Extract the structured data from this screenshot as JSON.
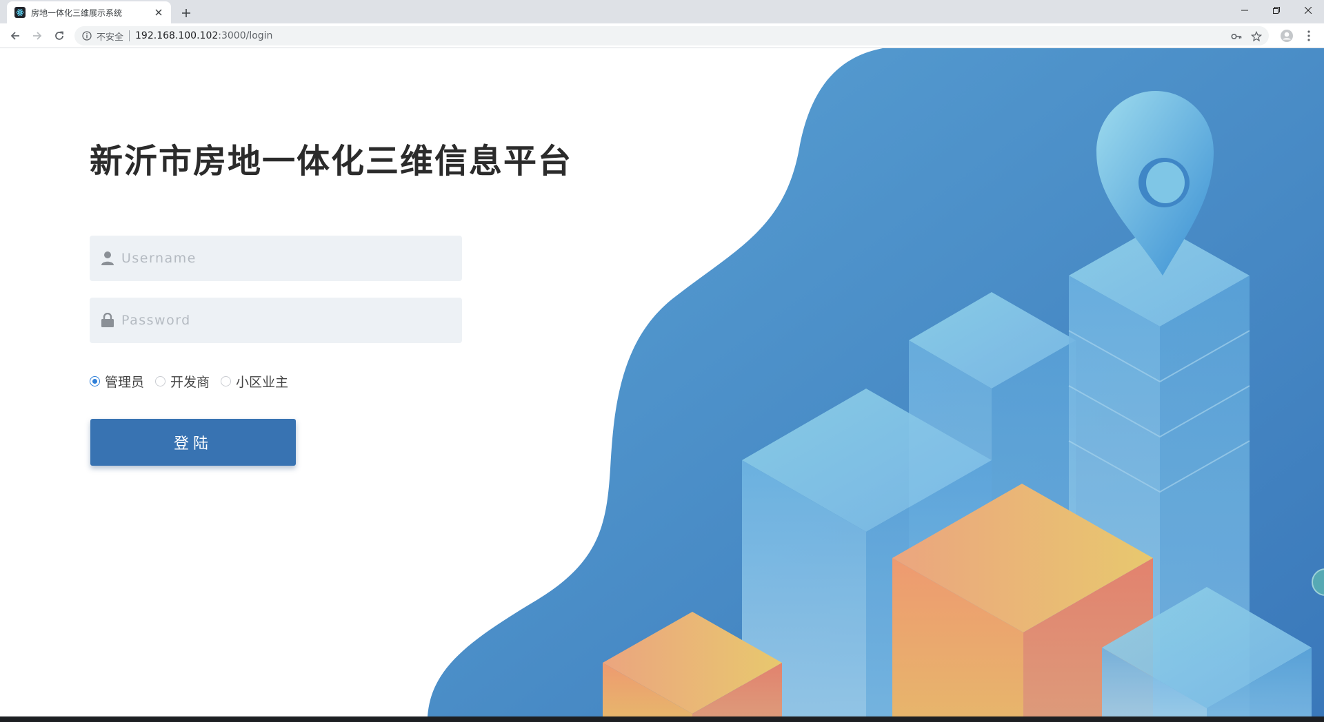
{
  "browser": {
    "tab_title": "房地一体化三维展示系统",
    "new_tab_label": "+",
    "address": {
      "security_label": "不安全",
      "host": "192.168.100.102",
      "path": ":3000/login"
    }
  },
  "login": {
    "title": "新沂市房地一体化三维信息平台",
    "username_placeholder": "Username",
    "password_placeholder": "Password",
    "roles": [
      {
        "label": "管理员",
        "checked": true
      },
      {
        "label": "开发商",
        "checked": false
      },
      {
        "label": "小区业主",
        "checked": false
      }
    ],
    "submit_label": "登陆"
  },
  "colors": {
    "accent": "#3873b2",
    "hero_blue": "#4a8bc6",
    "field_bg": "#edf1f5"
  }
}
